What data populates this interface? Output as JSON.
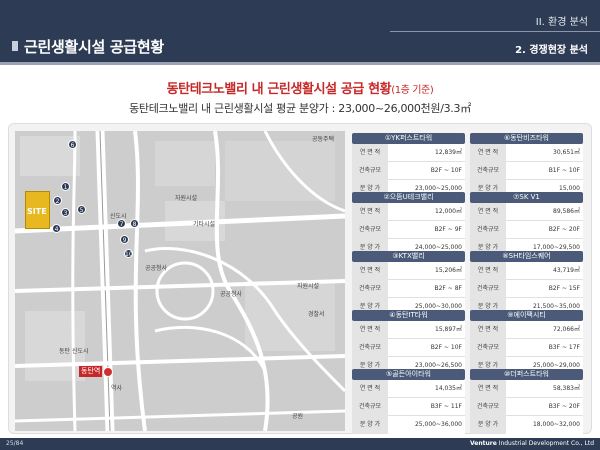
{
  "header": {
    "title": "근린생활시설 공급현황",
    "section": "II. 환경 분석",
    "subsection": "2. 경쟁현장 분석"
  },
  "headline": {
    "main": "동탄테크노밸리 내  근린생활시설 공급 현황",
    "note": "(1층 기준)",
    "subtitle": "동탄테크노밸리 내 근린생활시설 평균 분양가 : 23,000~26,000천원/3.3㎡"
  },
  "map": {
    "site_label": "SITE",
    "station_label": "동탄역",
    "labels": [
      "공동주택",
      "동탄 신도시",
      "자원시설",
      "공공청사",
      "기타시설",
      "공공청사",
      "신도시",
      "지원시설",
      "경찰서",
      "역사",
      "공원"
    ]
  },
  "row_keys": {
    "area": "연 면 적",
    "scale": "건축규모",
    "price": "분 양 가"
  },
  "cards": [
    {
      "title": "①YK퍼스트타워",
      "area": "12,839㎡",
      "scale": "B2F ~ 10F",
      "price": "23,000~25,000"
    },
    {
      "title": "⑥동탄비즈타워",
      "area": "30,651㎡",
      "scale": "B1F ~ 10F",
      "price": "15,000"
    },
    {
      "title": "②으뜸U테크밸리",
      "area": "12,000㎡",
      "scale": "B2F ~ 9F",
      "price": "24,000~25,000"
    },
    {
      "title": "⑦SK V1",
      "area": "89,586㎡",
      "scale": "B2F ~ 20F",
      "price": "17,000~29,500"
    },
    {
      "title": "③KTX밸리",
      "area": "15,206㎡",
      "scale": "B2F ~ 8F",
      "price": "25,000~30,000"
    },
    {
      "title": "⑧SH타임스퀘어",
      "area": "43,719㎡",
      "scale": "B2F ~ 15F",
      "price": "21,500~35,000"
    },
    {
      "title": "④동탄IT타워",
      "area": "15,897㎡",
      "scale": "B2F ~ 10F",
      "price": "23,000~26,500"
    },
    {
      "title": "⑨에이팩시티",
      "area": "72,066㎡",
      "scale": "B3F ~ 17F",
      "price": "25,000~29,000"
    },
    {
      "title": "⑤골든아이타워",
      "area": "14,035㎡",
      "scale": "B3F ~ 11F",
      "price": "25,000~36,000"
    },
    {
      "title": "⑩더퍼스트타워",
      "area": "58,383㎡",
      "scale": "B3F ~ 20F",
      "price": "18,000~32,000"
    }
  ],
  "footer": {
    "page": "25/84",
    "company_bold": "Venture",
    "company_rest": " Industrial Development Co., Ltd"
  },
  "colors": {
    "navy": "#2d3b54",
    "accent_red": "#c62828",
    "card_title": "#4a5a78",
    "site_yellow": "#e8b820"
  }
}
